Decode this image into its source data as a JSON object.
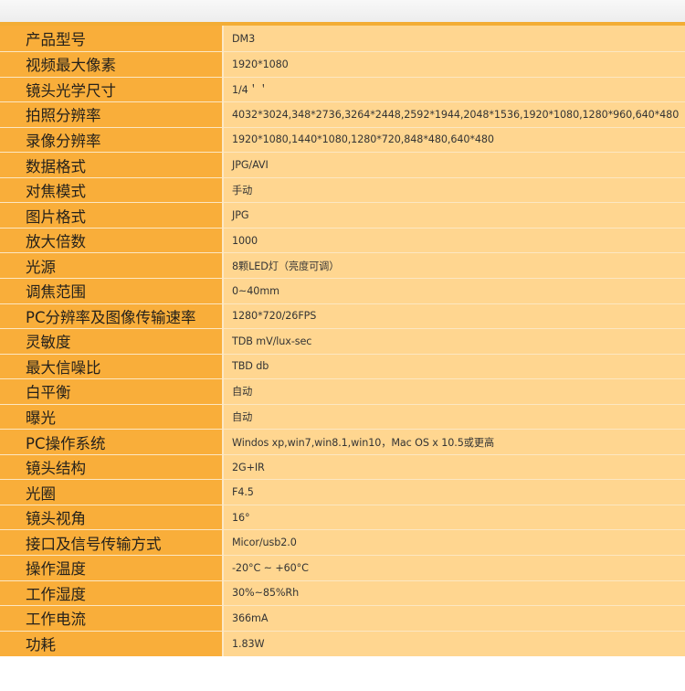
{
  "colors": {
    "label_background": "#f9ae3a",
    "value_background": "#ffd690",
    "top_rule": "#f3ad35"
  },
  "specs": [
    {
      "label": "产品型号",
      "value": "DM3"
    },
    {
      "label": "视频最大像素",
      "value": "1920*1080"
    },
    {
      "label": "镜头光学尺寸",
      "value": "1/4＇＇"
    },
    {
      "label": "拍照分辨率",
      "value": "4032*3024,348*2736,3264*2448,2592*1944,2048*1536,1920*1080,1280*960,640*480"
    },
    {
      "label": "录像分辨率",
      "value": "1920*1080,1440*1080,1280*720,848*480,640*480"
    },
    {
      "label": "数据格式",
      "value": "JPG/AVI"
    },
    {
      "label": "对焦模式",
      "value": "手动"
    },
    {
      "label": "图片格式",
      "value": "JPG"
    },
    {
      "label": "放大倍数",
      "value": "1000"
    },
    {
      "label": "光源",
      "value": "8颗LED灯（亮度可调）"
    },
    {
      "label": "调焦范围",
      "value": "0~40mm"
    },
    {
      "label": "PC分辨率及图像传输速率",
      "value": "1280*720/26FPS"
    },
    {
      "label": "灵敏度",
      "value": "TDB mV/lux-sec"
    },
    {
      "label": "最大信噪比",
      "value": "TBD db"
    },
    {
      "label": "白平衡",
      "value": "自动"
    },
    {
      "label": "曝光",
      "value": "自动"
    },
    {
      "label": "PC操作系统",
      "value": "Windos xp,win7,win8.1,win10，Mac OS x 10.5或更高"
    },
    {
      "label": "镜头结构",
      "value": "2G+IR"
    },
    {
      "label": "光圈",
      "value": "F4.5"
    },
    {
      "label": "镜头视角",
      "value": "16°"
    },
    {
      "label": "接口及信号传输方式",
      "value": "Micor/usb2.0"
    },
    {
      "label": "操作温度",
      "value": "-20°C ~ +60°C"
    },
    {
      "label": "工作湿度",
      "value": "30%~85%Rh"
    },
    {
      "label": "工作电流",
      "value": "366mA"
    },
    {
      "label": "功耗",
      "value": "1.83W"
    }
  ]
}
